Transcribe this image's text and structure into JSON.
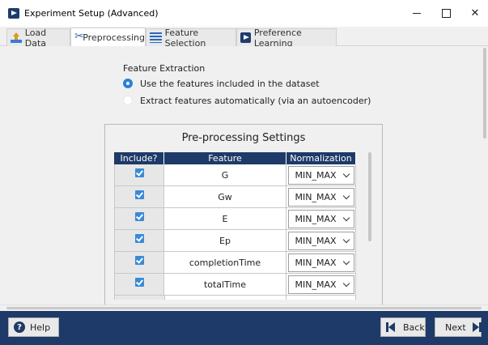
{
  "window": {
    "title": "Experiment Setup (Advanced)"
  },
  "tabs": [
    {
      "label": "Load Data",
      "icon": "upload-icon",
      "active": false
    },
    {
      "label": "Preprocessing",
      "icon": "scissors-icon",
      "active": true
    },
    {
      "label": "Feature Selection",
      "icon": "list-icon",
      "active": false
    },
    {
      "label": "Preference Learning",
      "icon": "app-logo-icon",
      "active": false
    }
  ],
  "feature_extraction": {
    "label": "Feature Extraction",
    "options": [
      {
        "label": "Use the features included in the dataset",
        "selected": true
      },
      {
        "label": "Extract features automatically (via an autoencoder)",
        "selected": false
      }
    ]
  },
  "settings": {
    "title": "Pre-processing Settings",
    "columns": [
      "Include?",
      "Feature",
      "Normalization"
    ],
    "rows": [
      {
        "include": true,
        "feature": "G",
        "normalization": "MIN_MAX"
      },
      {
        "include": true,
        "feature": "Gw",
        "normalization": "MIN_MAX"
      },
      {
        "include": true,
        "feature": "E",
        "normalization": "MIN_MAX"
      },
      {
        "include": true,
        "feature": "Ep",
        "normalization": "MIN_MAX"
      },
      {
        "include": true,
        "feature": "completionTime",
        "normalization": "MIN_MAX"
      },
      {
        "include": true,
        "feature": "totalTime",
        "normalization": "MIN_MAX"
      }
    ]
  },
  "footer": {
    "help_label": "Help",
    "back_label": "Back",
    "next_label": "Next"
  },
  "colors": {
    "accent": "#1d3a68",
    "radio_selected": "#2d7fd6",
    "checkbox": "#3a8ad8"
  }
}
